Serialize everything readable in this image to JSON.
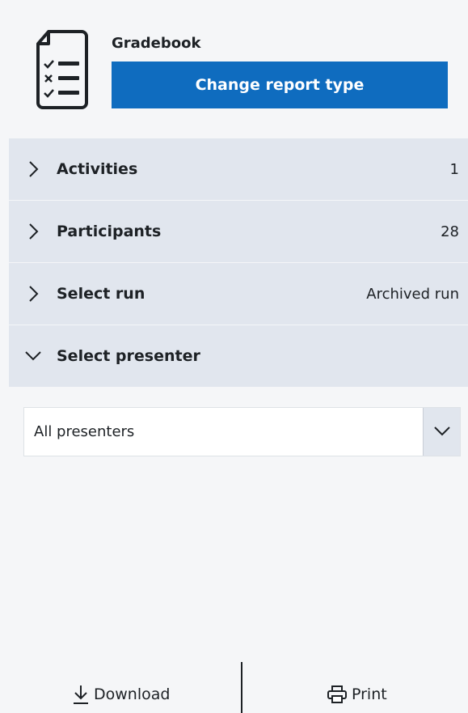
{
  "header": {
    "title": "Gradebook",
    "change_label": "Change report type",
    "icon": "checklist-icon"
  },
  "sections": [
    {
      "label": "Activities",
      "value": "1",
      "expanded": false
    },
    {
      "label": "Participants",
      "value": "28",
      "expanded": false
    },
    {
      "label": "Select run",
      "value": "Archived run",
      "expanded": false
    },
    {
      "label": "Select presenter",
      "value": "",
      "expanded": true
    }
  ],
  "presenter_select": {
    "selected": "All presenters"
  },
  "footer": {
    "download_label": "Download",
    "print_label": "Print"
  },
  "colors": {
    "primary": "#0f6cbf",
    "section_bg": "#e1e6ee"
  }
}
